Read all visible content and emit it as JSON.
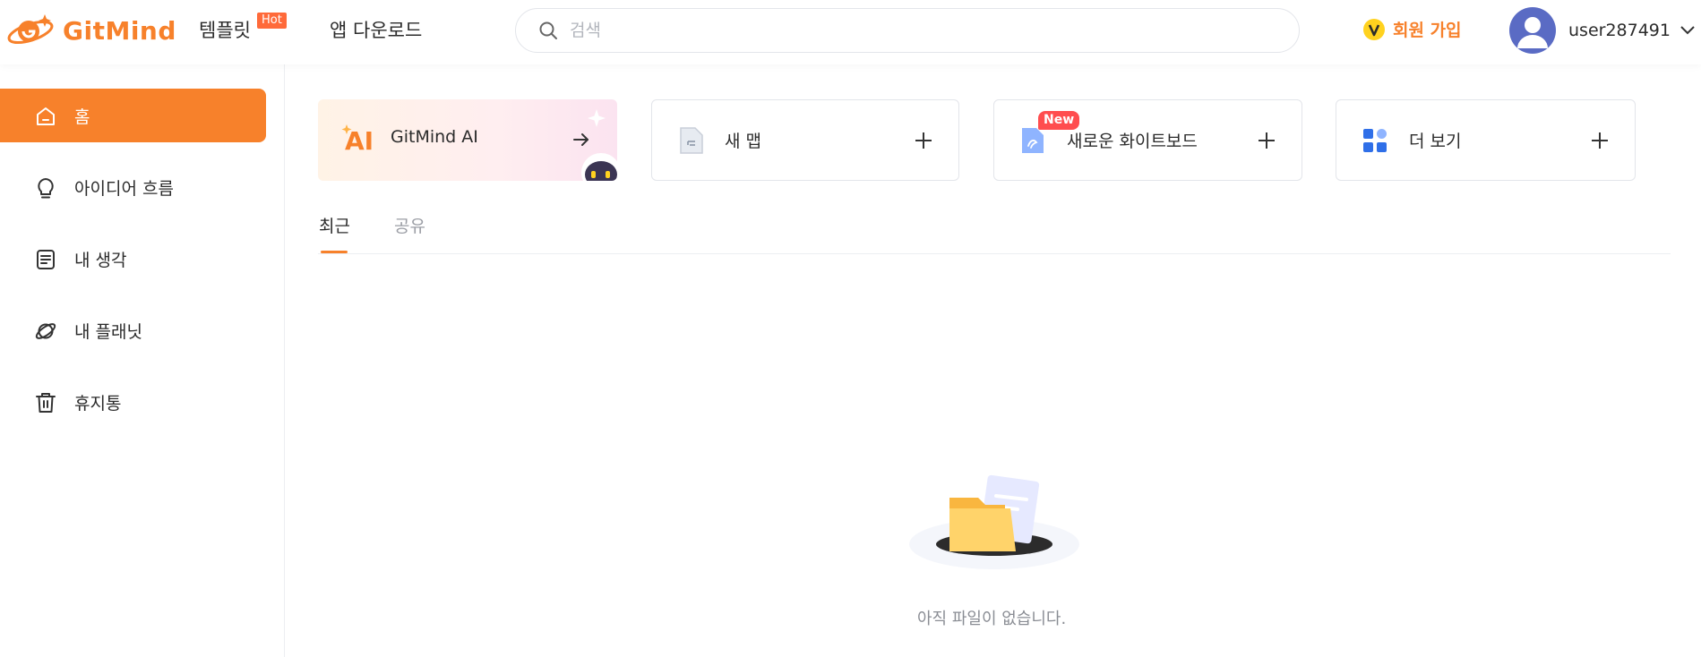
{
  "header": {
    "logo_text": "GitMind",
    "nav_templates": "템플릿",
    "hot_badge": "Hot",
    "nav_download": "앱 다운로드",
    "search_placeholder": "검색",
    "search_value": "",
    "signup_label": "회원 가입",
    "username": "user287491"
  },
  "sidebar": {
    "items": [
      {
        "label": "홈",
        "icon": "home-icon",
        "active": true
      },
      {
        "label": "아이디어 흐름",
        "icon": "lightbulb-icon",
        "active": false
      },
      {
        "label": "내 생각",
        "icon": "notes-icon",
        "active": false
      },
      {
        "label": "내 플래닛",
        "icon": "planet-icon",
        "active": false
      },
      {
        "label": "휴지통",
        "icon": "trash-icon",
        "active": false
      }
    ]
  },
  "cards": {
    "ai_label": "GitMind AI",
    "ai_icon_text": "AI",
    "new_map_label": "새 맵",
    "new_whiteboard_label": "새로운 화이트보드",
    "new_badge": "New",
    "more_label": "더 보기"
  },
  "tabs": [
    {
      "label": "최근",
      "active": true
    },
    {
      "label": "공유",
      "active": false
    }
  ],
  "empty_state": {
    "message": "아직 파일이 없습니다."
  },
  "colors": {
    "accent": "#f7812b",
    "badge_hot": "#ff6a3a",
    "badge_new": "#ff4d4f",
    "avatar": "#5a6bc4"
  }
}
